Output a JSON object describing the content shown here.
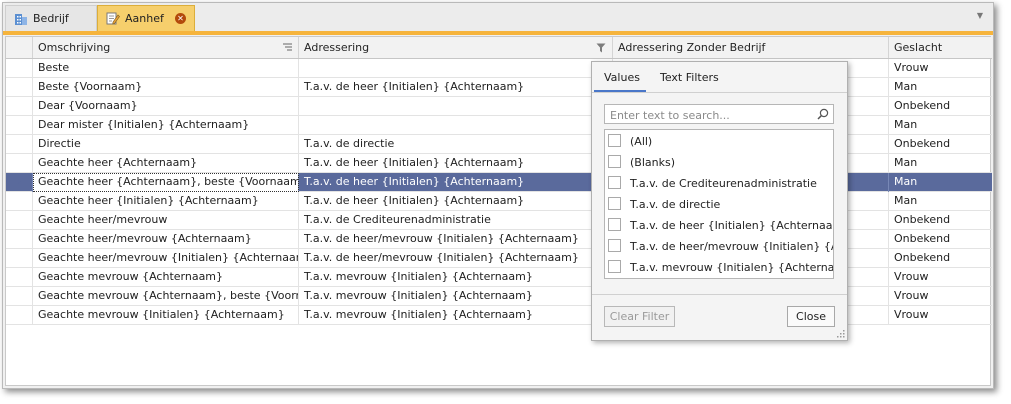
{
  "tabs": [
    {
      "label": "Bedrijf",
      "icon": "building-icon",
      "active": false
    },
    {
      "label": "Aanhef",
      "icon": "edit-document-icon",
      "active": true,
      "close_icon": "close-circle-icon"
    }
  ],
  "grid": {
    "columns": [
      {
        "label": "",
        "name": "indicator"
      },
      {
        "label": "Omschrijving",
        "icon": "sort-icon"
      },
      {
        "label": "Adressering",
        "icon": "filter-icon"
      },
      {
        "label": "Adressering Zonder Bedrijf"
      },
      {
        "label": "Geslacht"
      }
    ],
    "rows": [
      {
        "omschrijving": "Beste",
        "adressering": "",
        "zonder": "",
        "geslacht": "Vrouw"
      },
      {
        "omschrijving": "Beste {Voornaam}",
        "adressering": "T.a.v. de heer {Initialen} {Achternaam}",
        "zonder": "",
        "geslacht": "Man"
      },
      {
        "omschrijving": "Dear {Voornaam}",
        "adressering": "",
        "zonder": "",
        "geslacht": "Onbekend"
      },
      {
        "omschrijving": "Dear mister  {Initialen} {Achternaam}",
        "adressering": "",
        "zonder": "",
        "geslacht": "Man"
      },
      {
        "omschrijving": "Directie",
        "adressering": "T.a.v. de directie",
        "zonder": "",
        "geslacht": "Onbekend"
      },
      {
        "omschrijving": "Geachte heer {Achternaam}",
        "adressering": "T.a.v. de heer {Initialen} {Achternaam}",
        "zonder": "",
        "geslacht": "Man"
      },
      {
        "omschrijving": "Geachte heer {Achternaam}, beste {Voornaam}",
        "adressering": "T.a.v. de heer {Initialen} {Achternaam}",
        "zonder": "",
        "geslacht": "Man",
        "selected": true,
        "indicator": "→"
      },
      {
        "omschrijving": "Geachte heer {Initialen} {Achternaam}",
        "adressering": "T.a.v. de heer {Initialen} {Achternaam}",
        "zonder": "",
        "geslacht": "Man"
      },
      {
        "omschrijving": "Geachte heer/mevrouw",
        "adressering": "T.a.v. de Crediteurenadministratie",
        "zonder": "",
        "geslacht": "Onbekend"
      },
      {
        "omschrijving": "Geachte heer/mevrouw {Achternaam}",
        "adressering": "T.a.v. de heer/mevrouw {Initialen} {Achternaam}",
        "zonder": "",
        "geslacht": "Onbekend"
      },
      {
        "omschrijving": "Geachte heer/mevrouw {Initialen} {Achternaam}",
        "adressering": "T.a.v. de heer/mevrouw {Initialen} {Achternaam}",
        "zonder": "",
        "geslacht": "Onbekend"
      },
      {
        "omschrijving": "Geachte mevrouw {Achternaam}",
        "adressering": "T.a.v. mevrouw {Initialen} {Achternaam}",
        "zonder": "",
        "geslacht": "Vrouw"
      },
      {
        "omschrijving": "Geachte mevrouw {Achternaam}, beste {Voornaam}",
        "adressering": "T.a.v. mevrouw {Initialen} {Achternaam}",
        "zonder": "",
        "geslacht": "Vrouw"
      },
      {
        "omschrijving": "Geachte mevrouw {Initialen} {Achternaam}",
        "adressering": "T.a.v. mevrouw {Initialen} {Achternaam}",
        "zonder": "",
        "geslacht": "Vrouw"
      }
    ]
  },
  "filter_popup": {
    "tabs": [
      {
        "label": "Values",
        "active": true
      },
      {
        "label": "Text Filters",
        "active": false
      }
    ],
    "search_placeholder": "Enter text to search...",
    "search_icon": "magnifier-icon",
    "items": [
      {
        "label": "(All)",
        "checked": false
      },
      {
        "label": "(Blanks)",
        "checked": false
      },
      {
        "label": "T.a.v. de Crediteurenadministratie",
        "checked": false
      },
      {
        "label": "T.a.v. de directie",
        "checked": false
      },
      {
        "label": "T.a.v. de heer {Initialen} {Achternaam}",
        "checked": false
      },
      {
        "label": "T.a.v. de heer/mevrouw {Initialen} {A...",
        "checked": false
      },
      {
        "label": "T.a.v. mevrouw {Initialen} {Achternaa...",
        "checked": false
      }
    ],
    "clear_button": "Clear Filter",
    "close_button": "Close"
  },
  "colors": {
    "accent": "#f6b43c",
    "active_tab": "#f6cf6c",
    "selection": "#5a6a9c",
    "close_badge": "#b34a0b"
  }
}
